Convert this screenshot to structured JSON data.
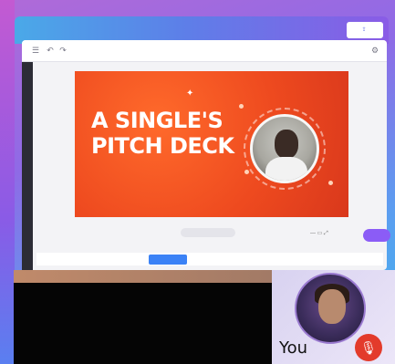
{
  "topbar": {
    "items": [
      "",
      "",
      "",
      ""
    ],
    "share_label": ""
  },
  "editor": {
    "title": "",
    "slide": {
      "title": "A SINGLE'S PITCH DECK",
      "subtitle": ""
    },
    "page_indicator": "",
    "bottom_bar": {
      "left_text": "",
      "button_label": "",
      "right_text": ""
    }
  },
  "call": {
    "self_label": "You"
  },
  "colors": {
    "slide_bg": "#ee4a1f",
    "mic_button": "#e33b2b",
    "accent_purple": "#8b5cf6",
    "primary_blue": "#3b82f6"
  }
}
